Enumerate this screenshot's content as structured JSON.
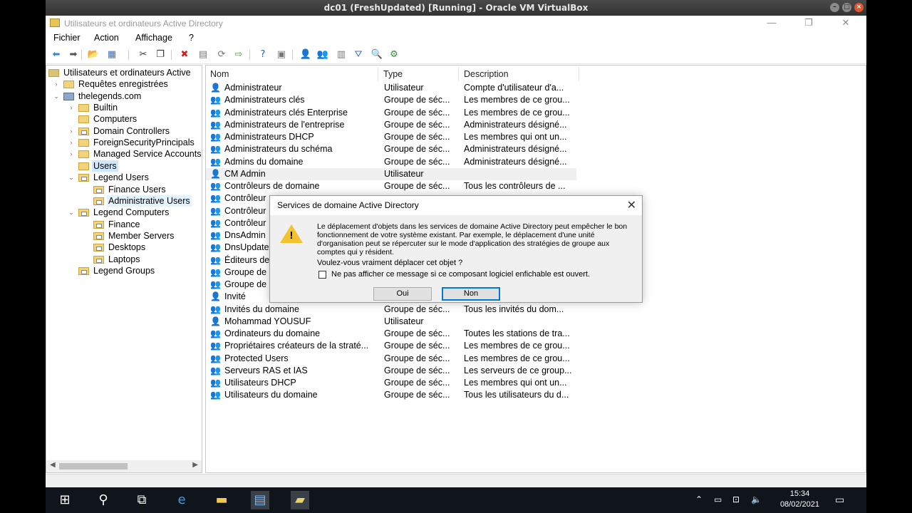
{
  "host": {
    "title": "dc01 (FreshUpdated) [Running] - Oracle VM VirtualBox"
  },
  "window": {
    "title": "Utilisateurs et ordinateurs Active Directory"
  },
  "menu": [
    "Fichier",
    "Action",
    "Affichage",
    "?"
  ],
  "toolbar": [
    {
      "name": "back-arrow-icon",
      "glyph": "⬅",
      "color": "#2f8ad8"
    },
    {
      "name": "forward-arrow-icon",
      "glyph": "➡",
      "color": "#555"
    },
    {
      "name": "up-folder-icon",
      "glyph": "📂",
      "color": "#d9a12d"
    },
    {
      "name": "show-tree-icon",
      "glyph": "▦",
      "color": "#3d6fb5"
    },
    {
      "name": "cut-icon",
      "glyph": "✂",
      "color": "#333"
    },
    {
      "name": "copy-icon",
      "glyph": "❐",
      "color": "#333"
    },
    {
      "name": "delete-icon",
      "glyph": "✖",
      "color": "#d32020"
    },
    {
      "name": "properties-icon",
      "glyph": "▤",
      "color": "#777"
    },
    {
      "name": "refresh-icon",
      "glyph": "⟳",
      "color": "#777"
    },
    {
      "name": "export-list-icon",
      "glyph": "⇨",
      "color": "#4a9a3a"
    },
    {
      "name": "help-icon",
      "glyph": "?",
      "color": "#2460b8"
    },
    {
      "name": "console-icon",
      "glyph": "▣",
      "color": "#777"
    },
    {
      "name": "new-user-icon",
      "glyph": "👤",
      "color": "#4a6fb0"
    },
    {
      "name": "new-group-icon",
      "glyph": "👥",
      "color": "#4a6fb0"
    },
    {
      "name": "new-ou-icon",
      "glyph": "▥",
      "color": "#777"
    },
    {
      "name": "filter-icon",
      "glyph": "⛛",
      "color": "#3d6fb5"
    },
    {
      "name": "find-icon",
      "glyph": "🔍",
      "color": "#c99a2e"
    },
    {
      "name": "add-to-group-icon",
      "glyph": "⚙",
      "color": "#3d8a3d"
    }
  ],
  "tree": [
    {
      "label": "Utilisateurs et ordinateurs Active",
      "level": 0,
      "exp": "",
      "icon": "root"
    },
    {
      "label": "Requêtes enregistrées",
      "level": 1,
      "exp": "›",
      "icon": "folder"
    },
    {
      "label": "thelegends.com",
      "level": 1,
      "exp": "⌄",
      "icon": "domain"
    },
    {
      "label": "Builtin",
      "level": 2,
      "exp": "›",
      "icon": "folder"
    },
    {
      "label": "Computers",
      "level": 2,
      "exp": "",
      "icon": "folder"
    },
    {
      "label": "Domain Controllers",
      "level": 2,
      "exp": "›",
      "icon": "ou"
    },
    {
      "label": "ForeignSecurityPrincipals",
      "level": 2,
      "exp": "›",
      "icon": "folder"
    },
    {
      "label": "Managed Service Accounts",
      "level": 2,
      "exp": "›",
      "icon": "folder"
    },
    {
      "label": "Users",
      "level": 2,
      "exp": "",
      "icon": "folder",
      "state": "selected"
    },
    {
      "label": "Legend Users",
      "level": 2,
      "exp": "⌄",
      "icon": "ou"
    },
    {
      "label": "Finance Users",
      "level": 3,
      "exp": "",
      "icon": "ou"
    },
    {
      "label": "Administrative Users",
      "level": 3,
      "exp": "",
      "icon": "ou",
      "state": "hover"
    },
    {
      "label": "Legend Computers",
      "level": 2,
      "exp": "⌄",
      "icon": "ou"
    },
    {
      "label": "Finance",
      "level": 3,
      "exp": "",
      "icon": "ou"
    },
    {
      "label": "Member Servers",
      "level": 3,
      "exp": "",
      "icon": "ou"
    },
    {
      "label": "Desktops",
      "level": 3,
      "exp": "",
      "icon": "ou"
    },
    {
      "label": "Laptops",
      "level": 3,
      "exp": "",
      "icon": "ou"
    },
    {
      "label": "Legend Groups",
      "level": 2,
      "exp": "",
      "icon": "ou"
    }
  ],
  "list": {
    "columns": [
      "Nom",
      "Type",
      "Description"
    ],
    "rows": [
      {
        "name": "Administrateur",
        "type": "Utilisateur",
        "desc": "Compte d'utilisateur d'a...",
        "kind": "user"
      },
      {
        "name": "Administrateurs clés",
        "type": "Groupe de séc...",
        "desc": "Les membres de ce grou...",
        "kind": "group"
      },
      {
        "name": "Administrateurs clés Enterprise",
        "type": "Groupe de séc...",
        "desc": "Les membres de ce grou...",
        "kind": "group"
      },
      {
        "name": "Administrateurs de l'entreprise",
        "type": "Groupe de séc...",
        "desc": "Administrateurs désigné...",
        "kind": "group"
      },
      {
        "name": "Administrateurs DHCP",
        "type": "Groupe de séc...",
        "desc": "Les membres qui ont un...",
        "kind": "group"
      },
      {
        "name": "Administrateurs du schéma",
        "type": "Groupe de séc...",
        "desc": "Administrateurs désigné...",
        "kind": "group"
      },
      {
        "name": "Admins du domaine",
        "type": "Groupe de séc...",
        "desc": "Administrateurs désigné...",
        "kind": "group"
      },
      {
        "name": "CM Admin",
        "type": "Utilisateur",
        "desc": "",
        "kind": "user",
        "state": "hl"
      },
      {
        "name": "Contrôleurs de domaine",
        "type": "Groupe de séc...",
        "desc": "Tous les contrôleurs de ...",
        "kind": "group"
      },
      {
        "name": "Contrôleur",
        "type": "",
        "desc": "",
        "kind": "group"
      },
      {
        "name": "Contrôleur",
        "type": "",
        "desc": "",
        "kind": "group"
      },
      {
        "name": "Contrôleur",
        "type": "",
        "desc": "",
        "kind": "group"
      },
      {
        "name": "DnsAdmin",
        "type": "",
        "desc": "",
        "kind": "group"
      },
      {
        "name": "DnsUpdate",
        "type": "",
        "desc": "",
        "kind": "group"
      },
      {
        "name": "Éditeurs de",
        "type": "",
        "desc": "",
        "kind": "group"
      },
      {
        "name": "Groupe de",
        "type": "",
        "desc": "",
        "kind": "group"
      },
      {
        "name": "Groupe de",
        "type": "",
        "desc": "",
        "kind": "group"
      },
      {
        "name": "Invité",
        "type": "",
        "desc": "",
        "kind": "user-guest"
      },
      {
        "name": "Invités du domaine",
        "type": "Groupe de séc...",
        "desc": "Tous les invités du dom...",
        "kind": "group"
      },
      {
        "name": "Mohammad YOUSUF",
        "type": "Utilisateur",
        "desc": "",
        "kind": "user"
      },
      {
        "name": "Ordinateurs du domaine",
        "type": "Groupe de séc...",
        "desc": "Toutes les stations de tra...",
        "kind": "group"
      },
      {
        "name": "Propriétaires créateurs de la straté...",
        "type": "Groupe de séc...",
        "desc": "Les membres de ce grou...",
        "kind": "group"
      },
      {
        "name": "Protected Users",
        "type": "Groupe de séc...",
        "desc": "Les membres de ce grou...",
        "kind": "group"
      },
      {
        "name": "Serveurs RAS et IAS",
        "type": "Groupe de séc...",
        "desc": "Les serveurs de ce group...",
        "kind": "group"
      },
      {
        "name": "Utilisateurs DHCP",
        "type": "Groupe de séc...",
        "desc": "Les membres qui ont un...",
        "kind": "group"
      },
      {
        "name": "Utilisateurs du domaine",
        "type": "Groupe de séc...",
        "desc": "Tous les utilisateurs du d...",
        "kind": "group"
      }
    ]
  },
  "dialog": {
    "title": "Services de domaine Active Directory",
    "message": "Le déplacement d'objets dans les services de domaine Active Directory peut empêcher le bon fonctionnement de votre système existant. Par exemple, le déplacement d'une unité d'organisation peut se répercuter sur le mode d'application des stratégies de groupe aux comptes qui y résident.",
    "question": "Voulez-vous vraiment déplacer cet objet ?",
    "checkbox": "Ne pas afficher ce message si ce composant logiciel enfichable est ouvert.",
    "yes": "Oui",
    "no": "Non"
  },
  "taskbar": {
    "time": "15:34",
    "date": "08/02/2021"
  }
}
